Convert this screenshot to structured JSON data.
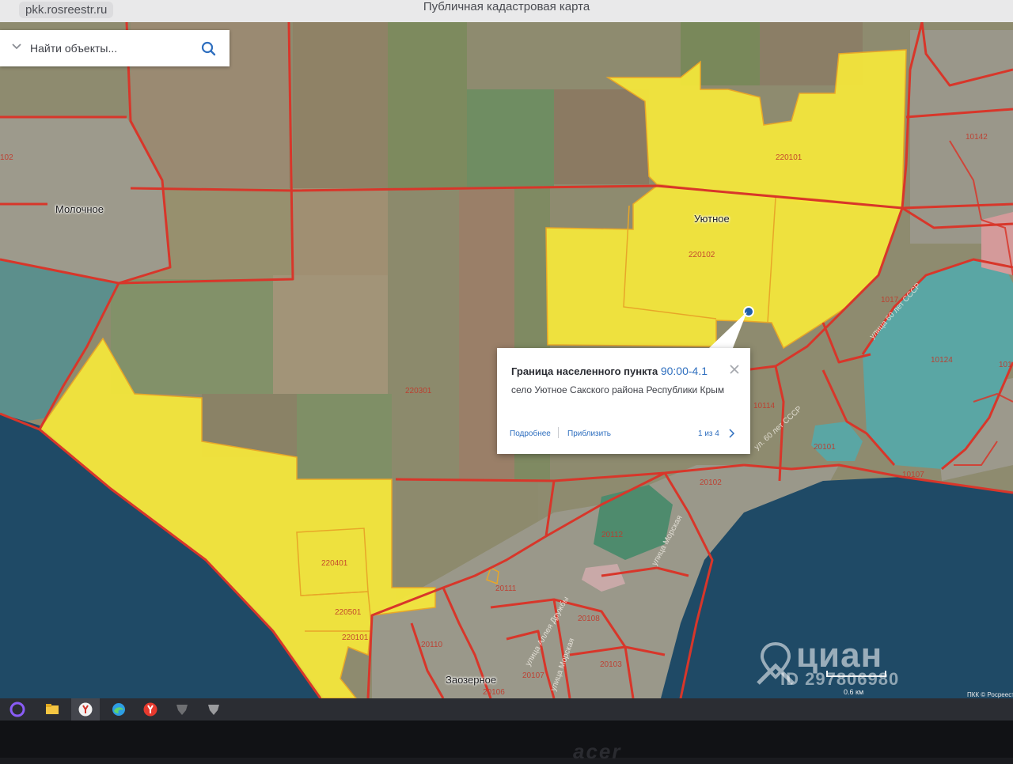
{
  "browser": {
    "url": "pkk.rosreestr.ru",
    "title": "Публичная кадастровая карта"
  },
  "search": {
    "placeholder": "Найти объекты...",
    "icon": "search-icon"
  },
  "map": {
    "places": [
      "Молочное",
      "Уютное",
      "Заозерное"
    ],
    "parcels": [
      "102",
      "220101",
      "220102",
      "220301",
      "220401",
      "220501",
      "220101",
      "10142",
      "1017",
      "10124",
      "101",
      "10114",
      "20101",
      "10107",
      "20102",
      "20112",
      "20111",
      "20108",
      "20110",
      "20107",
      "20106",
      "20103"
    ],
    "streets": [
      "улица 60 лет СССР",
      "ул. 60 лет СССР",
      "улица Аллея Дружбы",
      "улица Морская",
      "улица Морская"
    ],
    "colors": {
      "settlement_fill": "#f6e83a",
      "boundary": "#d8362a",
      "sea": "#1f4a66",
      "lake": "#5aa6a4"
    }
  },
  "popup": {
    "title": "Граница населенного пункта",
    "code": "90:00-4.1",
    "description": "село Уютное Сакского района Республики Крым",
    "more_label": "Подробнее",
    "zoom_label": "Приблизить",
    "pager": "1 из 4"
  },
  "scale": {
    "label": "0.6 км"
  },
  "attribution": "ПКК © Росреестр",
  "watermark": {
    "brand": "циан",
    "id": "ID 297806980"
  },
  "taskbar": {
    "icons": [
      "alice-icon",
      "folder-icon",
      "yandex-browser-icon",
      "edge-icon",
      "yandex-icon",
      "tanks-icon",
      "tanks-blitz-icon"
    ]
  },
  "bezel": {
    "brand": "acer"
  }
}
